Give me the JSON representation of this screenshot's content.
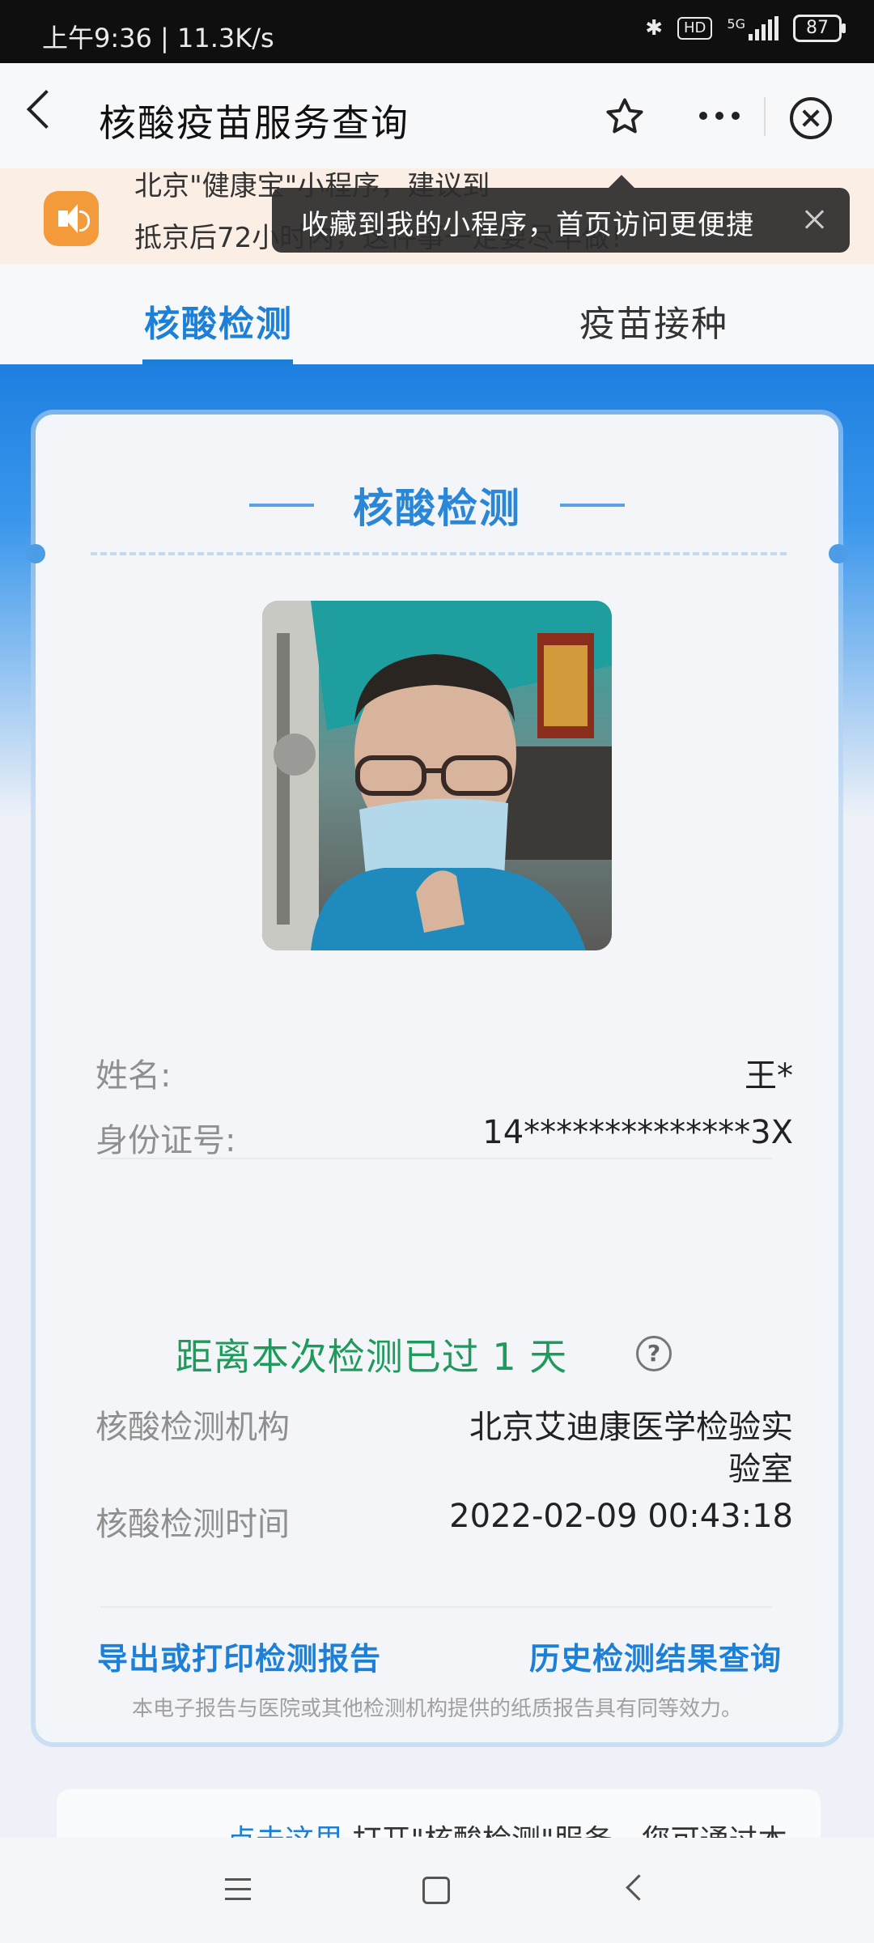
{
  "status_bar": {
    "time_speed": "上午9:36 | 11.3K/s",
    "hd": "HD",
    "net": "5G",
    "battery": "87"
  },
  "header": {
    "title": "核酸疫苗服务查询"
  },
  "notice": {
    "line1": "北京\"健康宝\"小程序，建议到",
    "line2": "抵京后72小时内，这件事一定要尽早做！"
  },
  "tooltip": {
    "text": "收藏到我的小程序，首页访问更便捷"
  },
  "tabs": [
    {
      "label": "核酸检测"
    },
    {
      "label": "疫苗接种"
    }
  ],
  "card": {
    "title": "核酸检测",
    "name_label": "姓名:",
    "name_value": "王*",
    "id_label": "身份证号:",
    "id_value": "14**************3X",
    "since_text": "距离本次检测已过 1 天",
    "help": "?",
    "org_label": "核酸检测机构",
    "org_value_line1": "北京艾迪康医学检验实",
    "org_value_line2": "验室",
    "time_label": "核酸检测时间",
    "time_value": "2022-02-09 00:43:18",
    "export_link": "导出或打印检测报告",
    "history_link": "历史检测结果查询",
    "disclaimer": "本电子报告与医院或其他检测机构提供的纸质报告具有同等效力。"
  },
  "bottom_card": {
    "link": "点击这里",
    "text": " 打开\"核酸检测\"服务，您可通过本"
  },
  "colors": {
    "accent": "#1c7fd8",
    "green": "#1f9a5c"
  }
}
